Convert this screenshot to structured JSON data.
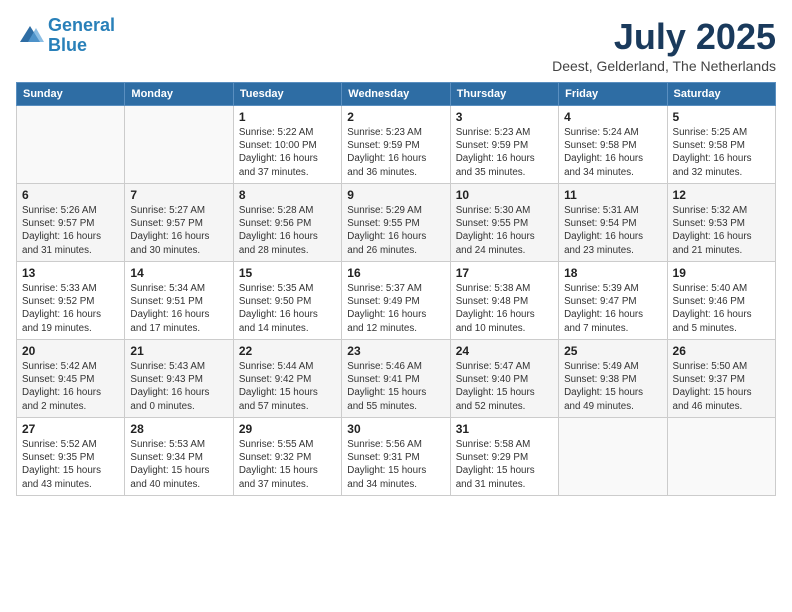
{
  "header": {
    "logo_line1": "General",
    "logo_line2": "Blue",
    "title": "July 2025",
    "location": "Deest, Gelderland, The Netherlands"
  },
  "columns": [
    "Sunday",
    "Monday",
    "Tuesday",
    "Wednesday",
    "Thursday",
    "Friday",
    "Saturday"
  ],
  "weeks": [
    [
      {
        "day": "",
        "info": ""
      },
      {
        "day": "",
        "info": ""
      },
      {
        "day": "1",
        "info": "Sunrise: 5:22 AM\nSunset: 10:00 PM\nDaylight: 16 hours\nand 37 minutes."
      },
      {
        "day": "2",
        "info": "Sunrise: 5:23 AM\nSunset: 9:59 PM\nDaylight: 16 hours\nand 36 minutes."
      },
      {
        "day": "3",
        "info": "Sunrise: 5:23 AM\nSunset: 9:59 PM\nDaylight: 16 hours\nand 35 minutes."
      },
      {
        "day": "4",
        "info": "Sunrise: 5:24 AM\nSunset: 9:58 PM\nDaylight: 16 hours\nand 34 minutes."
      },
      {
        "day": "5",
        "info": "Sunrise: 5:25 AM\nSunset: 9:58 PM\nDaylight: 16 hours\nand 32 minutes."
      }
    ],
    [
      {
        "day": "6",
        "info": "Sunrise: 5:26 AM\nSunset: 9:57 PM\nDaylight: 16 hours\nand 31 minutes."
      },
      {
        "day": "7",
        "info": "Sunrise: 5:27 AM\nSunset: 9:57 PM\nDaylight: 16 hours\nand 30 minutes."
      },
      {
        "day": "8",
        "info": "Sunrise: 5:28 AM\nSunset: 9:56 PM\nDaylight: 16 hours\nand 28 minutes."
      },
      {
        "day": "9",
        "info": "Sunrise: 5:29 AM\nSunset: 9:55 PM\nDaylight: 16 hours\nand 26 minutes."
      },
      {
        "day": "10",
        "info": "Sunrise: 5:30 AM\nSunset: 9:55 PM\nDaylight: 16 hours\nand 24 minutes."
      },
      {
        "day": "11",
        "info": "Sunrise: 5:31 AM\nSunset: 9:54 PM\nDaylight: 16 hours\nand 23 minutes."
      },
      {
        "day": "12",
        "info": "Sunrise: 5:32 AM\nSunset: 9:53 PM\nDaylight: 16 hours\nand 21 minutes."
      }
    ],
    [
      {
        "day": "13",
        "info": "Sunrise: 5:33 AM\nSunset: 9:52 PM\nDaylight: 16 hours\nand 19 minutes."
      },
      {
        "day": "14",
        "info": "Sunrise: 5:34 AM\nSunset: 9:51 PM\nDaylight: 16 hours\nand 17 minutes."
      },
      {
        "day": "15",
        "info": "Sunrise: 5:35 AM\nSunset: 9:50 PM\nDaylight: 16 hours\nand 14 minutes."
      },
      {
        "day": "16",
        "info": "Sunrise: 5:37 AM\nSunset: 9:49 PM\nDaylight: 16 hours\nand 12 minutes."
      },
      {
        "day": "17",
        "info": "Sunrise: 5:38 AM\nSunset: 9:48 PM\nDaylight: 16 hours\nand 10 minutes."
      },
      {
        "day": "18",
        "info": "Sunrise: 5:39 AM\nSunset: 9:47 PM\nDaylight: 16 hours\nand 7 minutes."
      },
      {
        "day": "19",
        "info": "Sunrise: 5:40 AM\nSunset: 9:46 PM\nDaylight: 16 hours\nand 5 minutes."
      }
    ],
    [
      {
        "day": "20",
        "info": "Sunrise: 5:42 AM\nSunset: 9:45 PM\nDaylight: 16 hours\nand 2 minutes."
      },
      {
        "day": "21",
        "info": "Sunrise: 5:43 AM\nSunset: 9:43 PM\nDaylight: 16 hours\nand 0 minutes."
      },
      {
        "day": "22",
        "info": "Sunrise: 5:44 AM\nSunset: 9:42 PM\nDaylight: 15 hours\nand 57 minutes."
      },
      {
        "day": "23",
        "info": "Sunrise: 5:46 AM\nSunset: 9:41 PM\nDaylight: 15 hours\nand 55 minutes."
      },
      {
        "day": "24",
        "info": "Sunrise: 5:47 AM\nSunset: 9:40 PM\nDaylight: 15 hours\nand 52 minutes."
      },
      {
        "day": "25",
        "info": "Sunrise: 5:49 AM\nSunset: 9:38 PM\nDaylight: 15 hours\nand 49 minutes."
      },
      {
        "day": "26",
        "info": "Sunrise: 5:50 AM\nSunset: 9:37 PM\nDaylight: 15 hours\nand 46 minutes."
      }
    ],
    [
      {
        "day": "27",
        "info": "Sunrise: 5:52 AM\nSunset: 9:35 PM\nDaylight: 15 hours\nand 43 minutes."
      },
      {
        "day": "28",
        "info": "Sunrise: 5:53 AM\nSunset: 9:34 PM\nDaylight: 15 hours\nand 40 minutes."
      },
      {
        "day": "29",
        "info": "Sunrise: 5:55 AM\nSunset: 9:32 PM\nDaylight: 15 hours\nand 37 minutes."
      },
      {
        "day": "30",
        "info": "Sunrise: 5:56 AM\nSunset: 9:31 PM\nDaylight: 15 hours\nand 34 minutes."
      },
      {
        "day": "31",
        "info": "Sunrise: 5:58 AM\nSunset: 9:29 PM\nDaylight: 15 hours\nand 31 minutes."
      },
      {
        "day": "",
        "info": ""
      },
      {
        "day": "",
        "info": ""
      }
    ]
  ]
}
